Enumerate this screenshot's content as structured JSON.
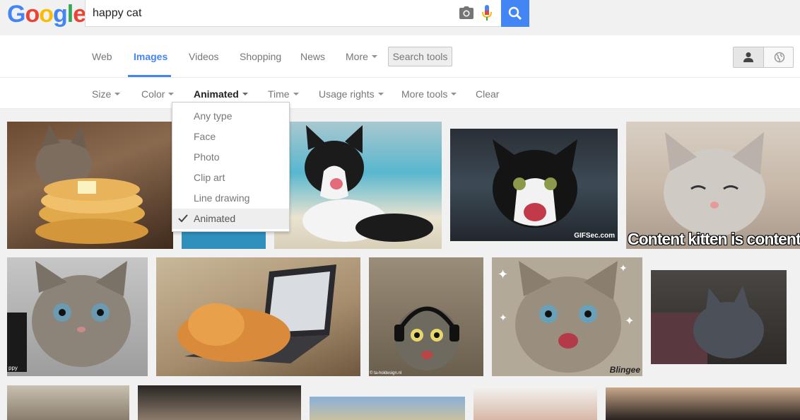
{
  "header": {
    "logo_letters": [
      "G",
      "o",
      "o",
      "g",
      "l",
      "e"
    ],
    "search_query": "happy cat"
  },
  "tabs": [
    {
      "label": "Web"
    },
    {
      "label": "Images",
      "active": true
    },
    {
      "label": "Videos"
    },
    {
      "label": "Shopping"
    },
    {
      "label": "News"
    },
    {
      "label": "More"
    }
  ],
  "search_tools_label": "Search tools",
  "tools": [
    {
      "label": "Size"
    },
    {
      "label": "Color"
    },
    {
      "label": "Animated",
      "active": true
    },
    {
      "label": "Time"
    },
    {
      "label": "Usage rights"
    },
    {
      "label": "More tools"
    },
    {
      "label": "Clear"
    }
  ],
  "type_dropdown": {
    "items": [
      "Any type",
      "Face",
      "Photo",
      "Clip art",
      "Line drawing",
      "Animated"
    ],
    "selected": "Animated"
  },
  "image_captions": {
    "img5": "Content kitten is content",
    "img4_watermark": "GIFSec.com",
    "img9_watermark": "Blingee",
    "img6_label": "ppy",
    "img8_watermark": "© ta-holdesign.nl"
  },
  "colors": {
    "accent": "#4285f4",
    "tab_text": "#777777",
    "active_text": "#222222"
  }
}
